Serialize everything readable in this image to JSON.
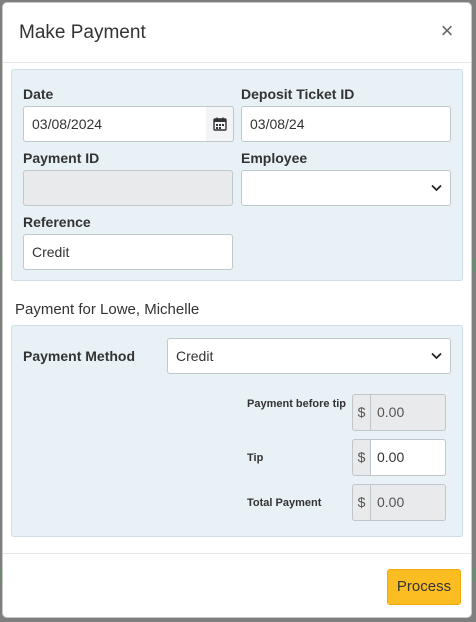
{
  "modal": {
    "title": "Make Payment",
    "close_glyph": "×"
  },
  "details": {
    "date_label": "Date",
    "date_value": "03/08/2024",
    "deposit_label": "Deposit Ticket ID",
    "deposit_value": "03/08/24",
    "payment_id_label": "Payment ID",
    "payment_id_value": "",
    "employee_label": "Employee",
    "employee_value": "",
    "reference_label": "Reference",
    "reference_value": "Credit"
  },
  "payment": {
    "heading": "Payment for Lowe, Michelle",
    "method_label": "Payment Method",
    "method_value": "Credit",
    "currency_symbol": "$",
    "before_tip_label": "Payment before tip",
    "before_tip_value": "0.00",
    "tip_label": "Tip",
    "tip_value": "0.00",
    "total_label": "Total Payment",
    "total_value": "0.00"
  },
  "footer": {
    "process_label": "Process"
  },
  "colors": {
    "panel": "#e7f1f6",
    "process_button": "#fbbd21"
  },
  "icons": [
    "close-icon",
    "calendar-icon",
    "chevron-down-icon"
  ]
}
